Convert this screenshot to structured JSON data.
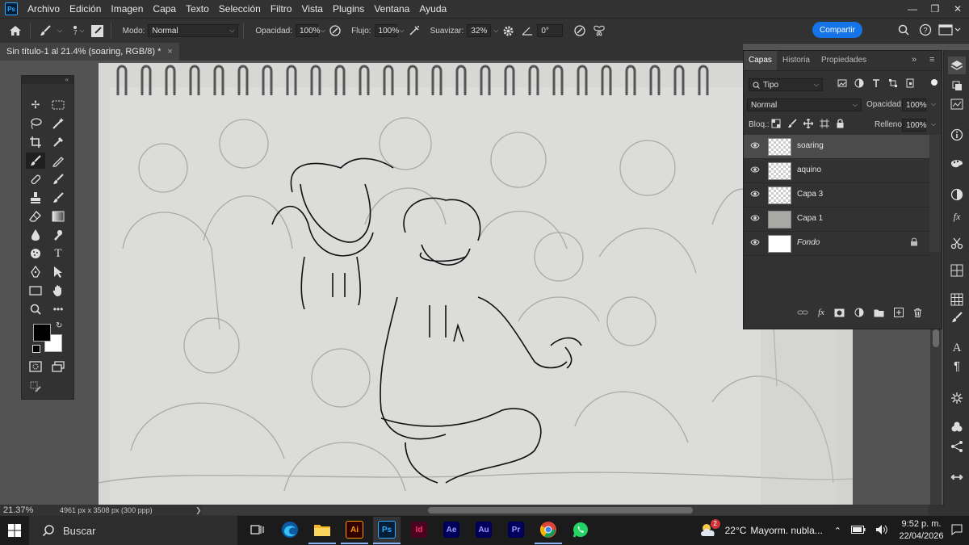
{
  "app": {
    "logo": "Ps",
    "menu": [
      "Archivo",
      "Edición",
      "Imagen",
      "Capa",
      "Texto",
      "Selección",
      "Filtro",
      "Vista",
      "Plugins",
      "Ventana",
      "Ayuda"
    ],
    "window_controls": [
      "minimize-icon",
      "restore-icon",
      "close-icon"
    ]
  },
  "options": {
    "brush_size": "7",
    "mode_label": "Modo:",
    "mode_value": "Normal",
    "opacity_label": "Opacidad:",
    "opacity_value": "100%",
    "flow_label": "Flujo:",
    "flow_value": "100%",
    "smooth_label": "Suavizar:",
    "smooth_value": "32%",
    "angle_value": "0°",
    "share_label": "Compartir"
  },
  "document": {
    "tab_title": "Sin título-1 al 21.4% (soaring, RGB/8) *",
    "zoom": "21.37%",
    "info": "4961 px x 3508 px (300 ppp)"
  },
  "layers_panel": {
    "tabs": [
      "Capas",
      "Historia",
      "Propiedades"
    ],
    "filter_value": "Tipo",
    "blend_value": "Normal",
    "opacity_label": "Opacidad:",
    "opacity_value": "100%",
    "lock_label": "Bloq.:",
    "fill_label": "Relleno:",
    "fill_value": "100%",
    "layers": [
      {
        "name": "soaring",
        "thumb": "transparent",
        "active": true
      },
      {
        "name": "aquino",
        "thumb": "transparent",
        "active": false
      },
      {
        "name": "Capa 3",
        "thumb": "transparent",
        "active": false
      },
      {
        "name": "Capa 1",
        "thumb": "photo",
        "active": false
      },
      {
        "name": "Fondo",
        "thumb": "white",
        "active": false,
        "locked": true
      }
    ]
  },
  "taskbar": {
    "search_placeholder": "Buscar",
    "apps": [
      {
        "name": "task-view",
        "label": ""
      },
      {
        "name": "edge",
        "label": ""
      },
      {
        "name": "file-explorer",
        "label": ""
      },
      {
        "name": "illustrator",
        "label": "Ai"
      },
      {
        "name": "photoshop",
        "label": "Ps"
      },
      {
        "name": "indesign",
        "label": "Id"
      },
      {
        "name": "after-effects",
        "label": "Ae"
      },
      {
        "name": "audition",
        "label": "Au"
      },
      {
        "name": "premiere",
        "label": "Pr"
      },
      {
        "name": "chrome",
        "label": ""
      },
      {
        "name": "whatsapp",
        "label": ""
      }
    ],
    "weather_temp": "22°C",
    "weather_text": "Mayorm. nubla...",
    "weather_badge": "2",
    "time": "9:52 p. m.",
    "date": "22/04/2026"
  },
  "colors": {
    "accent": "#1473e6",
    "foreground": "#000000",
    "background": "#ffffff"
  }
}
